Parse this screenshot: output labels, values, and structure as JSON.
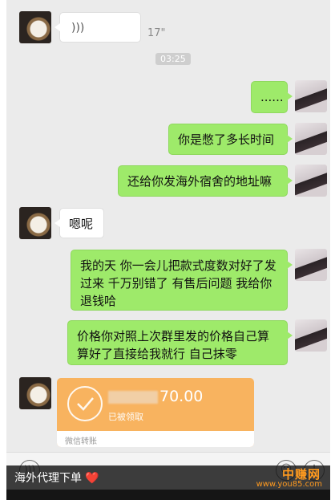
{
  "chat": {
    "voice_icon": "voice-wave-icon",
    "voice_duration": "17\"",
    "timestamp": "03:25",
    "msg_ellipsis": "......",
    "msg_1": "你是憋了多长时间",
    "msg_2": "还给你发海外宿舍的地址嘛",
    "msg_reply": "嗯呢",
    "msg_3": "我的天 你一会儿把款式度数对好了发过来 千万别错了 有售后问题 我给你退钱哈",
    "msg_4": "价格你对照上次群里发的价格自己算算好了直接给我就行 自己抹零"
  },
  "transfer": {
    "amount": "70.00",
    "status": "已被领取",
    "footer": "微信转账",
    "color": "#f8b35f"
  },
  "input_bar": {
    "voice_toggle_icon": "voice-icon",
    "emoji_icon": "emoji-icon",
    "plus_icon": "plus-icon"
  },
  "caption": {
    "text": "海外代理下单",
    "heart": "❤️"
  },
  "watermark": {
    "cn": "中赚网",
    "url": "www.you85.com"
  },
  "colors": {
    "bubble_green": "#9eea6a",
    "chat_bg": "#ebebeb",
    "watermark": "#ff9a1f"
  }
}
